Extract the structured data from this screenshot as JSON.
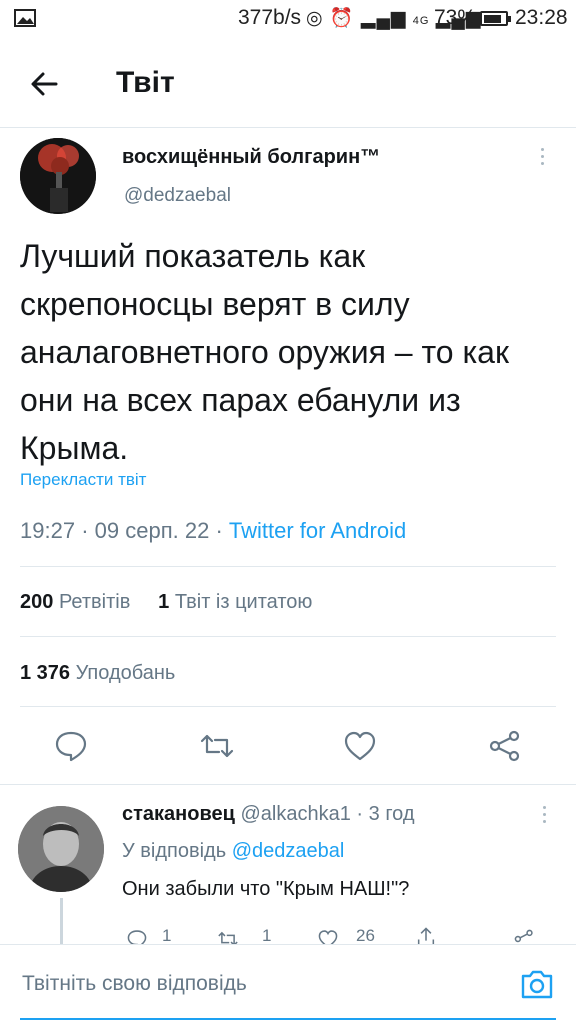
{
  "status_bar": {
    "net_speed": "377b/s",
    "network": "4G",
    "battery": "73%",
    "time": "23:28"
  },
  "header": {
    "title": "Твіт"
  },
  "tweet": {
    "author_name": "восхищённый болгарин™",
    "handle": "@dedzaebal",
    "text": "Лучший показатель как скрепоносцы верят в силу аналаговнетного оружия – то как они на всех парах ебанули из Крыма.",
    "translate": "Перекласти твіт",
    "time": "19:27",
    "date": "09 серп. 22",
    "source": "Twitter for Android",
    "retweets_count": "200",
    "retweets_label": "Ретвітів",
    "quotes_count": "1",
    "quotes_label": "Твіт із цитатою",
    "likes_count": "1 376",
    "likes_label": "Уподобань"
  },
  "reply": {
    "name": "стакановец",
    "handle": "@alkachka1",
    "age": "3 год",
    "reply_prefix": "У відповідь",
    "reply_to": "@dedzaebal",
    "text": "Они забыли что \"Крым НАШ!\"?",
    "reply_count": "1",
    "retweet_count": "1",
    "like_count": "26"
  },
  "compose": {
    "placeholder": "Твітніть свою відповідь"
  },
  "colors": {
    "accent": "#1da1f2",
    "secondary_text": "#657786",
    "divider": "#e1e8ed"
  },
  "icons": {
    "back": "arrow-left-icon",
    "more": "kebab-icon",
    "reply": "reply-icon",
    "retweet": "retweet-icon",
    "like": "heart-icon",
    "share": "share-icon",
    "camera": "camera-icon"
  }
}
